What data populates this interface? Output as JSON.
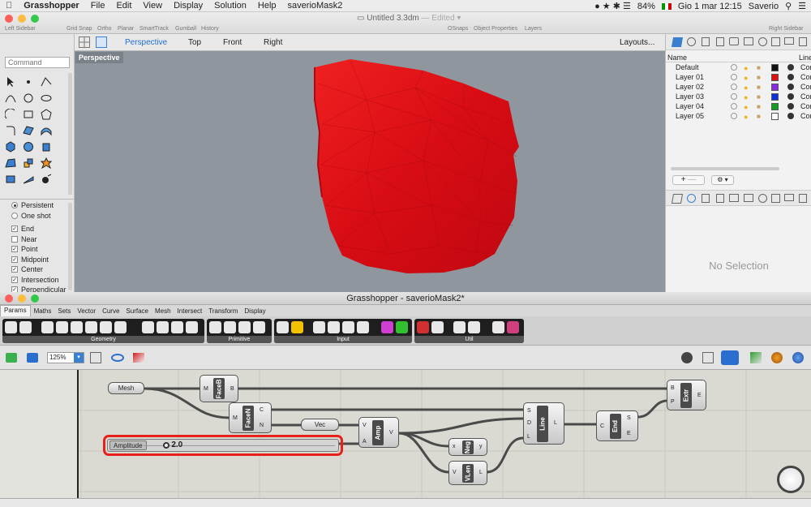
{
  "menubar": {
    "app": "Grasshopper",
    "items": [
      "File",
      "Edit",
      "View",
      "Display",
      "Solution",
      "Help",
      "saverioMask2"
    ],
    "battery": "84%",
    "datetime": "Gio 1 mar  12:15",
    "user": "Saverio"
  },
  "titlebar": {
    "doc_title": "Untitled 3.3dm",
    "doc_status": "— Edited ▾",
    "left_sidebar": "Left Sidebar",
    "right_sidebar": "Right Sidebar",
    "toggles": [
      "Grid Snap",
      "Ortho",
      "Planar",
      "SmartTrack",
      "Gumball",
      "History"
    ],
    "right_toggles": [
      "OSnaps",
      "Object Properties",
      "Layers"
    ]
  },
  "command": {
    "placeholder": "Command"
  },
  "osnap": {
    "persistent": "Persistent",
    "one_shot": "One shot",
    "items": [
      {
        "label": "End",
        "checked": "✓"
      },
      {
        "label": "Near",
        "checked": ""
      },
      {
        "label": "Point",
        "checked": "✓"
      },
      {
        "label": "Midpoint",
        "checked": "✓"
      },
      {
        "label": "Center",
        "checked": "✓"
      },
      {
        "label": "Intersection",
        "checked": "✓"
      },
      {
        "label": "Perpendicular",
        "checked": "✓"
      }
    ]
  },
  "viewport": {
    "tabs": [
      "Perspective",
      "Top",
      "Front",
      "Right"
    ],
    "active": "Perspective",
    "layouts": "Layouts...",
    "label": "Perspective",
    "object_color": "#e01018"
  },
  "layers": {
    "col_name": "Name",
    "col_line": "Line",
    "rows": [
      {
        "name": "Default",
        "color": "#111111",
        "lt": "Con"
      },
      {
        "name": "Layer 01",
        "color": "#e01010",
        "lt": "Con"
      },
      {
        "name": "Layer 02",
        "color": "#8a2be2",
        "lt": "Con"
      },
      {
        "name": "Layer 03",
        "color": "#1030e0",
        "lt": "Con"
      },
      {
        "name": "Layer 04",
        "color": "#10a020",
        "lt": "Con"
      },
      {
        "name": "Layer 05",
        "color": "#ffffff",
        "lt": "Con"
      }
    ],
    "add": "+",
    "remove": "—",
    "gear": "⚙ ▾"
  },
  "properties": {
    "empty": "No Selection"
  },
  "grasshopper": {
    "title": "Grasshopper - saverioMask2*",
    "tabs": [
      "Params",
      "Maths",
      "Sets",
      "Vector",
      "Curve",
      "Surface",
      "Mesh",
      "Intersect",
      "Transform",
      "Display"
    ],
    "active_tab": "Params",
    "ribbon_groups": [
      "Geometry",
      "Primitive",
      "Input",
      "Util"
    ],
    "zoom": "125%",
    "components": {
      "mesh": "Mesh",
      "faceb": "FaceB",
      "facen": "FaceN",
      "vec": "Vec",
      "amp": "Amp",
      "neg": "Neg",
      "vlen": "VLen",
      "line": "Line",
      "end": "End",
      "extr": "Extr"
    },
    "ports": {
      "faceb_in": "M",
      "faceb_out": "B",
      "facen_in": "M",
      "facen_out1": "C",
      "facen_out2": "N",
      "amp_in1": "V",
      "amp_in2": "A",
      "amp_out": "V",
      "neg_in": "x",
      "neg_out": "y",
      "vlen_in": "V",
      "vlen_out": "L",
      "line_in1": "S",
      "line_in2": "D",
      "line_in3": "L",
      "line_out": "L",
      "end_in": "C",
      "end_out1": "S",
      "end_out2": "E",
      "extr_in1": "B",
      "extr_in2": "P",
      "extr_out": "E"
    },
    "slider": {
      "label": "Amplitude",
      "value": "2.0",
      "fraction": 0.12
    },
    "highlight_color": "#e8201a"
  }
}
